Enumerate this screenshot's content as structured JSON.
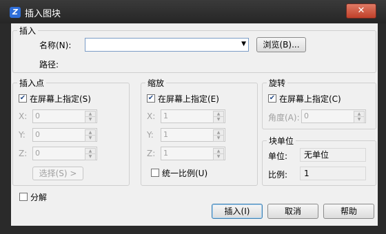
{
  "title": "插入图块",
  "close_label": "✕",
  "insert_group": {
    "label": "插入",
    "name_label": "名称(N):",
    "name_value": "",
    "browse_label": "浏览(B)...",
    "path_label": "路径:"
  },
  "insertion_point": {
    "label": "插入点",
    "on_screen_label": "在屏幕上指定(S)",
    "on_screen_checked": true,
    "x_label": "X:",
    "x_value": "0",
    "y_label": "Y:",
    "y_value": "0",
    "z_label": "Z:",
    "z_value": "0",
    "select_label": "选择(S) >"
  },
  "scale": {
    "label": "缩放",
    "on_screen_label": "在屏幕上指定(E)",
    "on_screen_checked": true,
    "x_label": "X:",
    "x_value": "1",
    "y_label": "Y:",
    "y_value": "1",
    "z_label": "Z:",
    "z_value": "1",
    "uniform_label": "统一比例(U)",
    "uniform_checked": false
  },
  "rotation": {
    "label": "旋转",
    "on_screen_label": "在屏幕上指定(C)",
    "on_screen_checked": true,
    "angle_label": "角度(A):",
    "angle_value": "0"
  },
  "block_unit": {
    "label": "块单位",
    "unit_label": "单位:",
    "unit_value": "无单位",
    "ratio_label": "比例:",
    "ratio_value": "1"
  },
  "explode_label": "分解",
  "explode_checked": false,
  "buttons": {
    "insert": "插入(I)",
    "cancel": "取消",
    "help": "帮助"
  }
}
